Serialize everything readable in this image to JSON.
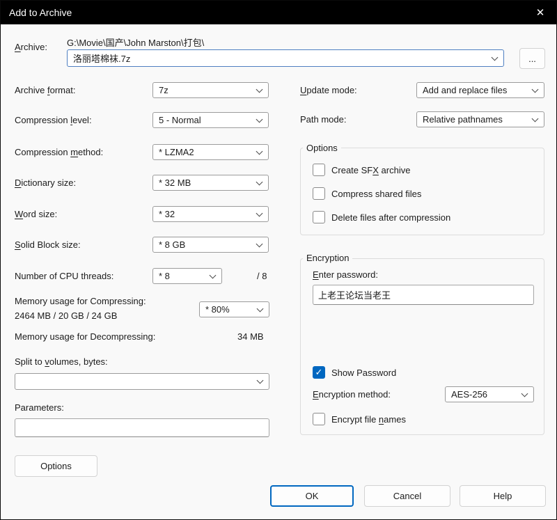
{
  "window": {
    "title": "Add to Archive",
    "close_icon": "✕"
  },
  "accent_color": "#0067c0",
  "archive": {
    "label": "&Archive:",
    "folder": "G:\\Movie\\国产\\John Marston\\打包\\",
    "filename": "洛丽塔棉袜.7z",
    "browse_label": "..."
  },
  "left": {
    "archive_format": {
      "label": "Archive &format:",
      "value": "7z"
    },
    "compression_level": {
      "label": "Compression &level:",
      "value": "5 - Normal"
    },
    "compression_method": {
      "label": "Compression &method:",
      "value": "* LZMA2"
    },
    "dictionary_size": {
      "label": "&Dictionary size:",
      "value": "* 32 MB"
    },
    "word_size": {
      "label": "&Word size:",
      "value": "* 32"
    },
    "solid_block_size": {
      "label": "&Solid Block size:",
      "value": "* 8 GB"
    },
    "cpu_threads": {
      "label": "Number of CPU threads:",
      "value": "* 8",
      "max": "/ 8"
    },
    "memory_compress": {
      "label": "Memory usage for Compressing:",
      "detail": "2464 MB / 20 GB / 24 GB",
      "value": "* 80%"
    },
    "memory_decompress": {
      "label": "Memory usage for Decompressing:",
      "value": "34 MB"
    },
    "split_volumes": {
      "label": "Split to &volumes, bytes:",
      "value": ""
    },
    "parameters": {
      "label": "Parameters:",
      "value": ""
    },
    "options_button": "Options"
  },
  "right": {
    "update_mode": {
      "label": "&Update mode:",
      "value": "Add and replace files"
    },
    "path_mode": {
      "label": "Path mode:",
      "value": "Relative pathnames"
    },
    "options_group": {
      "title": "Options",
      "items": [
        {
          "label": "Create SF&X archive",
          "checked": false
        },
        {
          "label": "Compress shared files",
          "checked": false
        },
        {
          "label": "Delete files after compression",
          "checked": false
        }
      ]
    },
    "encryption": {
      "title": "Encryption",
      "password_label": "&Enter password:",
      "password_value": "上老王论坛当老王",
      "show_password": {
        "label": "Show Password",
        "checked": true
      },
      "method": {
        "label": "&Encryption method:",
        "value": "AES-256"
      },
      "encrypt_names": {
        "label": "Encrypt file &names",
        "checked": false
      }
    }
  },
  "footer": {
    "ok": "OK",
    "cancel": "Cancel",
    "help": "Help"
  }
}
